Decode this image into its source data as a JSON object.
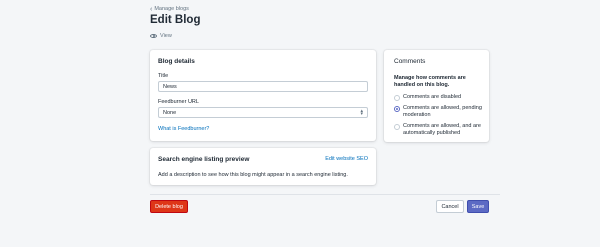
{
  "breadcrumb": {
    "label": "Manage blogs"
  },
  "page": {
    "title": "Edit Blog",
    "view_label": "View"
  },
  "blog_details": {
    "title": "Blog details",
    "title_label": "Title",
    "title_value": "News",
    "feedburner_label": "Feedburner URL",
    "feedburner_value": "None",
    "feedburner_help": "What is Feedburner?"
  },
  "seo": {
    "title": "Search engine listing preview",
    "edit_label": "Edit website SEO",
    "description": "Add a description to see how this blog might appear in a search engine listing."
  },
  "comments": {
    "title": "Comments",
    "subtitle": "Manage how comments are handled on this blog.",
    "options": [
      {
        "label": "Comments are disabled",
        "selected": false
      },
      {
        "label": "Comments are allowed, pending moderation",
        "selected": true
      },
      {
        "label": "Comments are allowed, and are automatically published",
        "selected": false
      }
    ]
  },
  "actions": {
    "delete_label": "Delete blog",
    "cancel_label": "Cancel",
    "save_label": "Save"
  },
  "colors": {
    "accent": "#5c6ac4",
    "danger": "#de3618",
    "link": "#006fbb",
    "background": "#f4f6f8"
  }
}
